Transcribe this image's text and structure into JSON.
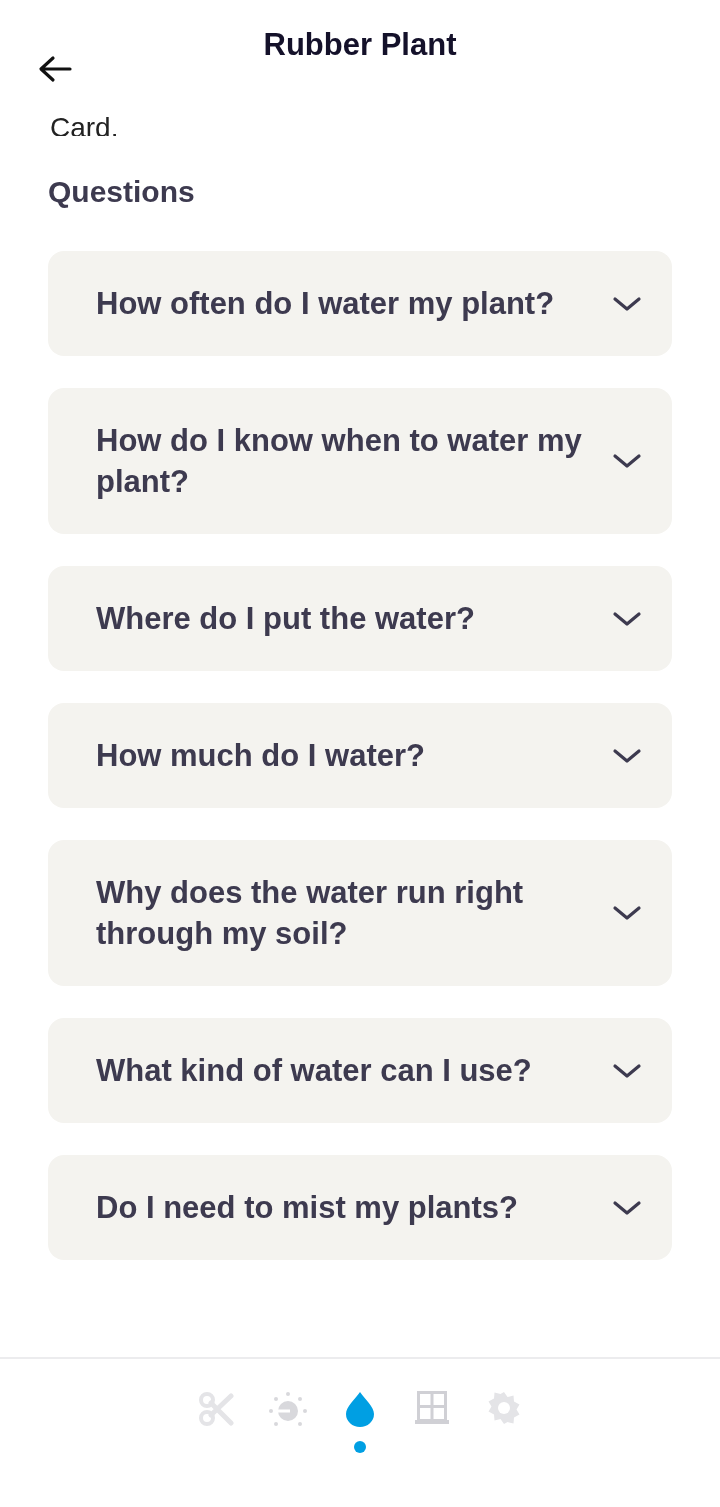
{
  "header": {
    "title": "Rubber Plant"
  },
  "partial_text": "Card.",
  "section_title": "Questions",
  "questions": [
    {
      "text": "How often do I water my plant?",
      "expanded": false
    },
    {
      "text": "How do I know when to water my plant?",
      "expanded": false
    },
    {
      "text": "Where do I put the water?",
      "expanded": false
    },
    {
      "text": "How much do I water?",
      "expanded": false
    },
    {
      "text": "Why does the water run right through my soil?",
      "expanded": false
    },
    {
      "text": "What kind of water can I use?",
      "expanded": false
    },
    {
      "text": "Do I need to mist my plants?",
      "expanded": false
    }
  ],
  "bottom_nav": [
    {
      "kind": "scissors",
      "selected": false
    },
    {
      "kind": "light",
      "selected": false
    },
    {
      "kind": "water",
      "selected": true
    },
    {
      "kind": "window",
      "selected": false
    },
    {
      "kind": "gear",
      "selected": false
    }
  ]
}
